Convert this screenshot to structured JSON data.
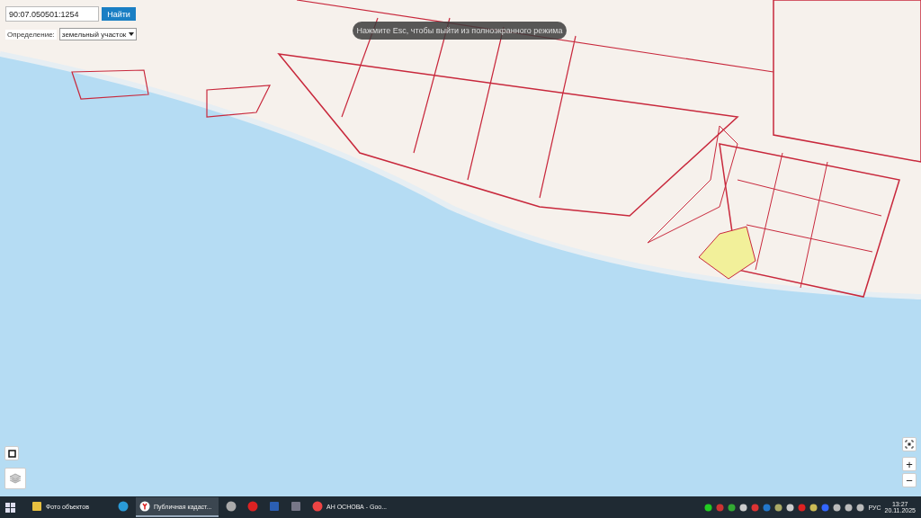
{
  "search": {
    "value": "90:07.050501:1254",
    "button": "Найти"
  },
  "definition": {
    "label": "Определение:",
    "value": "земельный участок"
  },
  "fullscreen_notice": "Нажмите Esc, чтобы выйти из полноэкранного режима",
  "zoom_controls": [
    "+",
    "−"
  ],
  "taskbar": {
    "apps": [
      {
        "kind": "folder",
        "label": "Фото объектов",
        "selected": false
      },
      {
        "kind": "edge",
        "selected": false
      },
      {
        "kind": "yandex",
        "label": "Публичная кадаст...",
        "selected": true
      },
      {
        "kind": "round",
        "selected": false
      },
      {
        "kind": "pdf",
        "selected": false
      },
      {
        "kind": "word",
        "selected": false
      },
      {
        "kind": "calc",
        "selected": false
      },
      {
        "kind": "chrome",
        "label": "АН ОСНОВА - Goo...",
        "selected": false
      }
    ],
    "language": "РУС",
    "time": "13:27",
    "date": "20.11.2025"
  }
}
